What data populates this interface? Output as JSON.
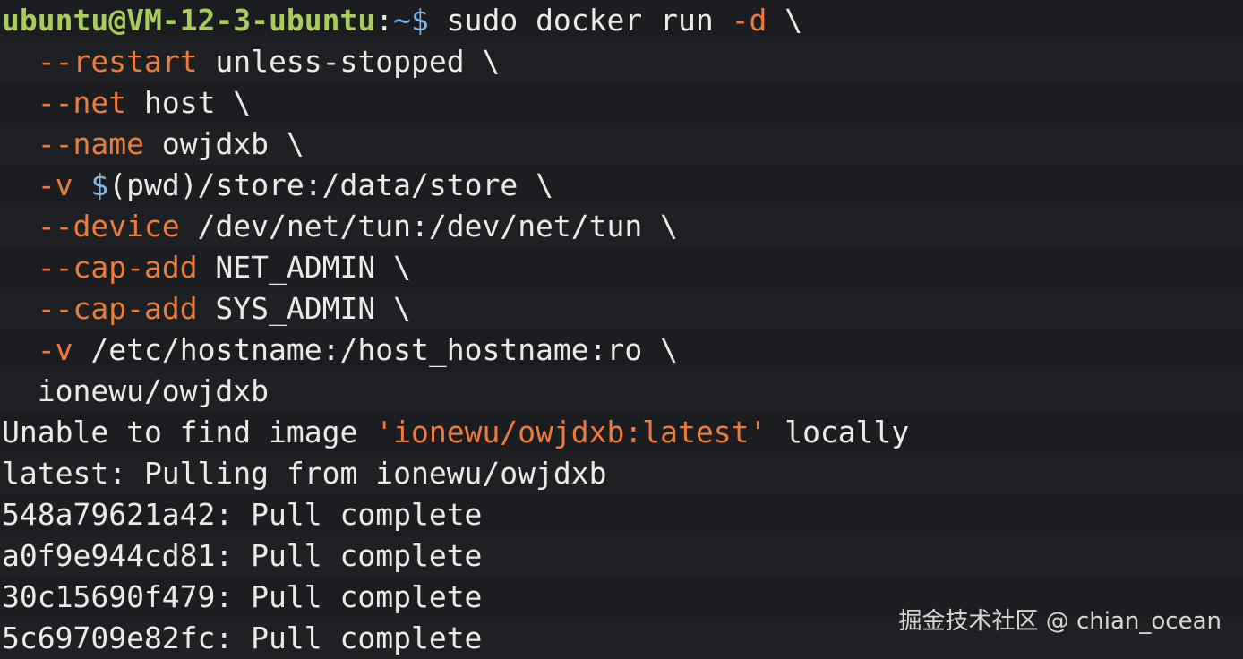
{
  "colors": {
    "background": "#1c1d20",
    "prompt_user": "#a8cc5e",
    "prompt_path": "#7fb6e6",
    "flag": "#ec7b3c",
    "text": "#eaeaea"
  },
  "prompt": {
    "user_host": "ubuntu@VM-12-3-ubuntu",
    "sep": ":",
    "path": "~$",
    "command": " sudo docker run ",
    "flag": "-d",
    "cont": " \\"
  },
  "args": [
    {
      "indent": "  ",
      "flag": "--restart",
      "value": " unless-stopped \\"
    },
    {
      "indent": "  ",
      "flag": "--net",
      "value": " host \\"
    },
    {
      "indent": "  ",
      "flag": "--name",
      "value": " owjdxb \\"
    },
    {
      "indent": "  ",
      "flag": "-v",
      "dollar": " $",
      "value": "(pwd)/store:/data/store \\"
    },
    {
      "indent": "  ",
      "flag": "--device",
      "value": " /dev/net/tun:/dev/net/tun \\"
    },
    {
      "indent": "  ",
      "flag": "--cap-add",
      "value": " NET_ADMIN \\"
    },
    {
      "indent": "  ",
      "flag": "--cap-add",
      "value": " SYS_ADMIN \\"
    },
    {
      "indent": "  ",
      "flag": "-v",
      "value": " /etc/hostname:/host_hostname:ro \\"
    }
  ],
  "image_line": "  ionewu/owjdxb",
  "unable_line": {
    "pre": "Unable to find image ",
    "quoted": "'ionewu/owjdxb:latest'",
    "post": " locally"
  },
  "output_lines": [
    "latest: Pulling from ionewu/owjdxb",
    "548a79621a42: Pull complete",
    "a0f9e944cd81: Pull complete",
    "30c15690f479: Pull complete",
    "5c69709e82fc: Pull complete"
  ],
  "watermark": "掘金技术社区 @ chian_ocean"
}
